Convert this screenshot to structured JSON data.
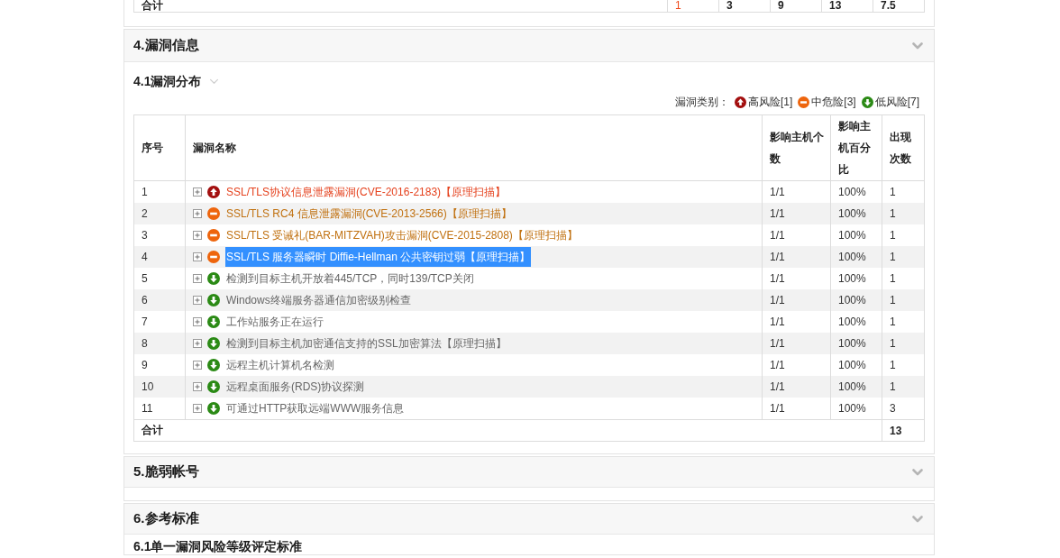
{
  "previous_table": {
    "total_row": {
      "label": "合计",
      "cells": [
        {
          "text": "1",
          "kind": "high"
        },
        {
          "text": "3",
          "kind": "plain"
        },
        {
          "text": "9",
          "kind": "plain"
        },
        {
          "text": "13",
          "kind": "plain"
        },
        {
          "text": "7.5",
          "kind": "plain"
        }
      ]
    }
  },
  "sections": [
    {
      "title": "4.漏洞信息",
      "subsections": [
        {
          "title": "4.1漏洞分布",
          "toggle": true,
          "legend": {
            "label": "漏洞类别：",
            "items": [
              {
                "kind": "high",
                "label": "高风险[1]"
              },
              {
                "kind": "medium",
                "label": "中危险[3]"
              },
              {
                "kind": "low",
                "label": "低风险[7]"
              }
            ]
          },
          "table": {
            "columns": [
              "序号",
              "漏洞名称",
              "影响主机个数",
              "影响主机百分比",
              "出现次数"
            ],
            "rows": [
              {
                "no": "1",
                "kind": "high",
                "name": "SSL/TLS协议信息泄露漏洞(CVE-2016-2183)【原理扫描】",
                "hosts": "1/1",
                "percent": "100%",
                "count": "1",
                "selected": false
              },
              {
                "no": "2",
                "kind": "medium",
                "name": "SSL/TLS RC4 信息泄露漏洞(CVE-2013-2566)【原理扫描】",
                "hosts": "1/1",
                "percent": "100%",
                "count": "1",
                "selected": false
              },
              {
                "no": "3",
                "kind": "medium",
                "name": "SSL/TLS 受诫礼(BAR-MITZVAH)攻击漏洞(CVE-2015-2808)【原理扫描】",
                "hosts": "1/1",
                "percent": "100%",
                "count": "1",
                "selected": false
              },
              {
                "no": "4",
                "kind": "medium",
                "name": "SSL/TLS 服务器瞬时 Diffie-Hellman 公共密钥过弱【原理扫描】",
                "hosts": "1/1",
                "percent": "100%",
                "count": "1",
                "selected": true
              },
              {
                "no": "5",
                "kind": "low",
                "name": "检测到目标主机开放着445/TCP，同时139/TCP关闭",
                "hosts": "1/1",
                "percent": "100%",
                "count": "1",
                "selected": false
              },
              {
                "no": "6",
                "kind": "low",
                "name": "Windows终端服务器通信加密级别检查",
                "hosts": "1/1",
                "percent": "100%",
                "count": "1",
                "selected": false
              },
              {
                "no": "7",
                "kind": "low",
                "name": "工作站服务正在运行",
                "hosts": "1/1",
                "percent": "100%",
                "count": "1",
                "selected": false
              },
              {
                "no": "8",
                "kind": "low",
                "name": "检测到目标主机加密通信支持的SSL加密算法【原理扫描】",
                "hosts": "1/1",
                "percent": "100%",
                "count": "1",
                "selected": false
              },
              {
                "no": "9",
                "kind": "low",
                "name": "远程主机计算机名检测",
                "hosts": "1/1",
                "percent": "100%",
                "count": "1",
                "selected": false
              },
              {
                "no": "10",
                "kind": "low",
                "name": "远程桌面服务(RDS)协议探测",
                "hosts": "1/1",
                "percent": "100%",
                "count": "1",
                "selected": false
              },
              {
                "no": "11",
                "kind": "low",
                "name": "可通过HTTP获取远端WWW服务信息",
                "hosts": "1/1",
                "percent": "100%",
                "count": "3",
                "selected": false
              }
            ],
            "total_row": {
              "label": "合计",
              "count": "13"
            }
          }
        }
      ]
    },
    {
      "title": "5.脆弱帐号"
    },
    {
      "title": "6.参考标准",
      "subsections": [
        {
          "title": "6.1单一漏洞风险等级评定标准"
        }
      ]
    }
  ]
}
